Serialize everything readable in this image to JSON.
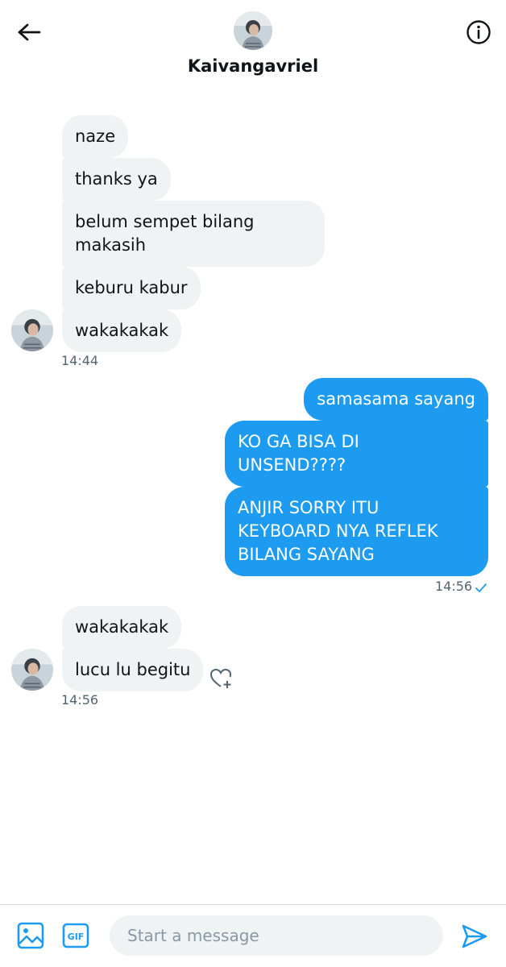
{
  "header": {
    "name": "Kaivangavriel"
  },
  "messages": {
    "group1": [
      "naze",
      "thanks ya",
      "belum sempet bilang\nmakasih",
      "keburu kabur",
      "wakakakak"
    ],
    "group1_time": "14:44",
    "group2": [
      "samasama sayang",
      "KO GA BISA DI\nUNSEND????",
      "ANJIR SORRY ITU\nKEYBOARD NYA REFLEK\nBILANG SAYANG"
    ],
    "group2_time": "14:56",
    "group3": [
      "wakakakak",
      "lucu lu begitu"
    ],
    "group3_time": "14:56"
  },
  "composer": {
    "placeholder": "Start a message",
    "gif_label": "GIF"
  },
  "colors": {
    "accent": "#1d9bf0",
    "incoming_bubble": "#eff3f4"
  }
}
